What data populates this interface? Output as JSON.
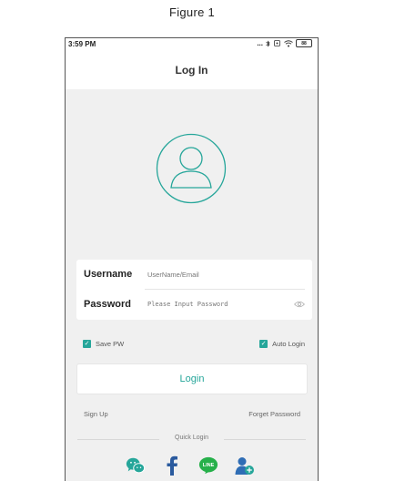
{
  "figure_caption": "Figure 1",
  "status_bar": {
    "time": "3:59 PM",
    "dots": "...",
    "battery": "88"
  },
  "header": {
    "title": "Log In"
  },
  "form": {
    "username_label": "Username",
    "username_placeholder": "UserName/Email",
    "password_label": "Password",
    "password_placeholder": "Please Input Password"
  },
  "options": {
    "save_pw": "Save PW",
    "auto_login": "Auto Login"
  },
  "login_button": "Login",
  "links": {
    "sign_up": "Sign Up",
    "forget_password": "Forget Password"
  },
  "quick_login": {
    "label": "Quick Login",
    "items": [
      "wechat-icon",
      "facebook-icon",
      "line-icon",
      "add-contact-icon"
    ]
  },
  "colors": {
    "accent": "#26a69a",
    "background": "#f0f0f0"
  }
}
